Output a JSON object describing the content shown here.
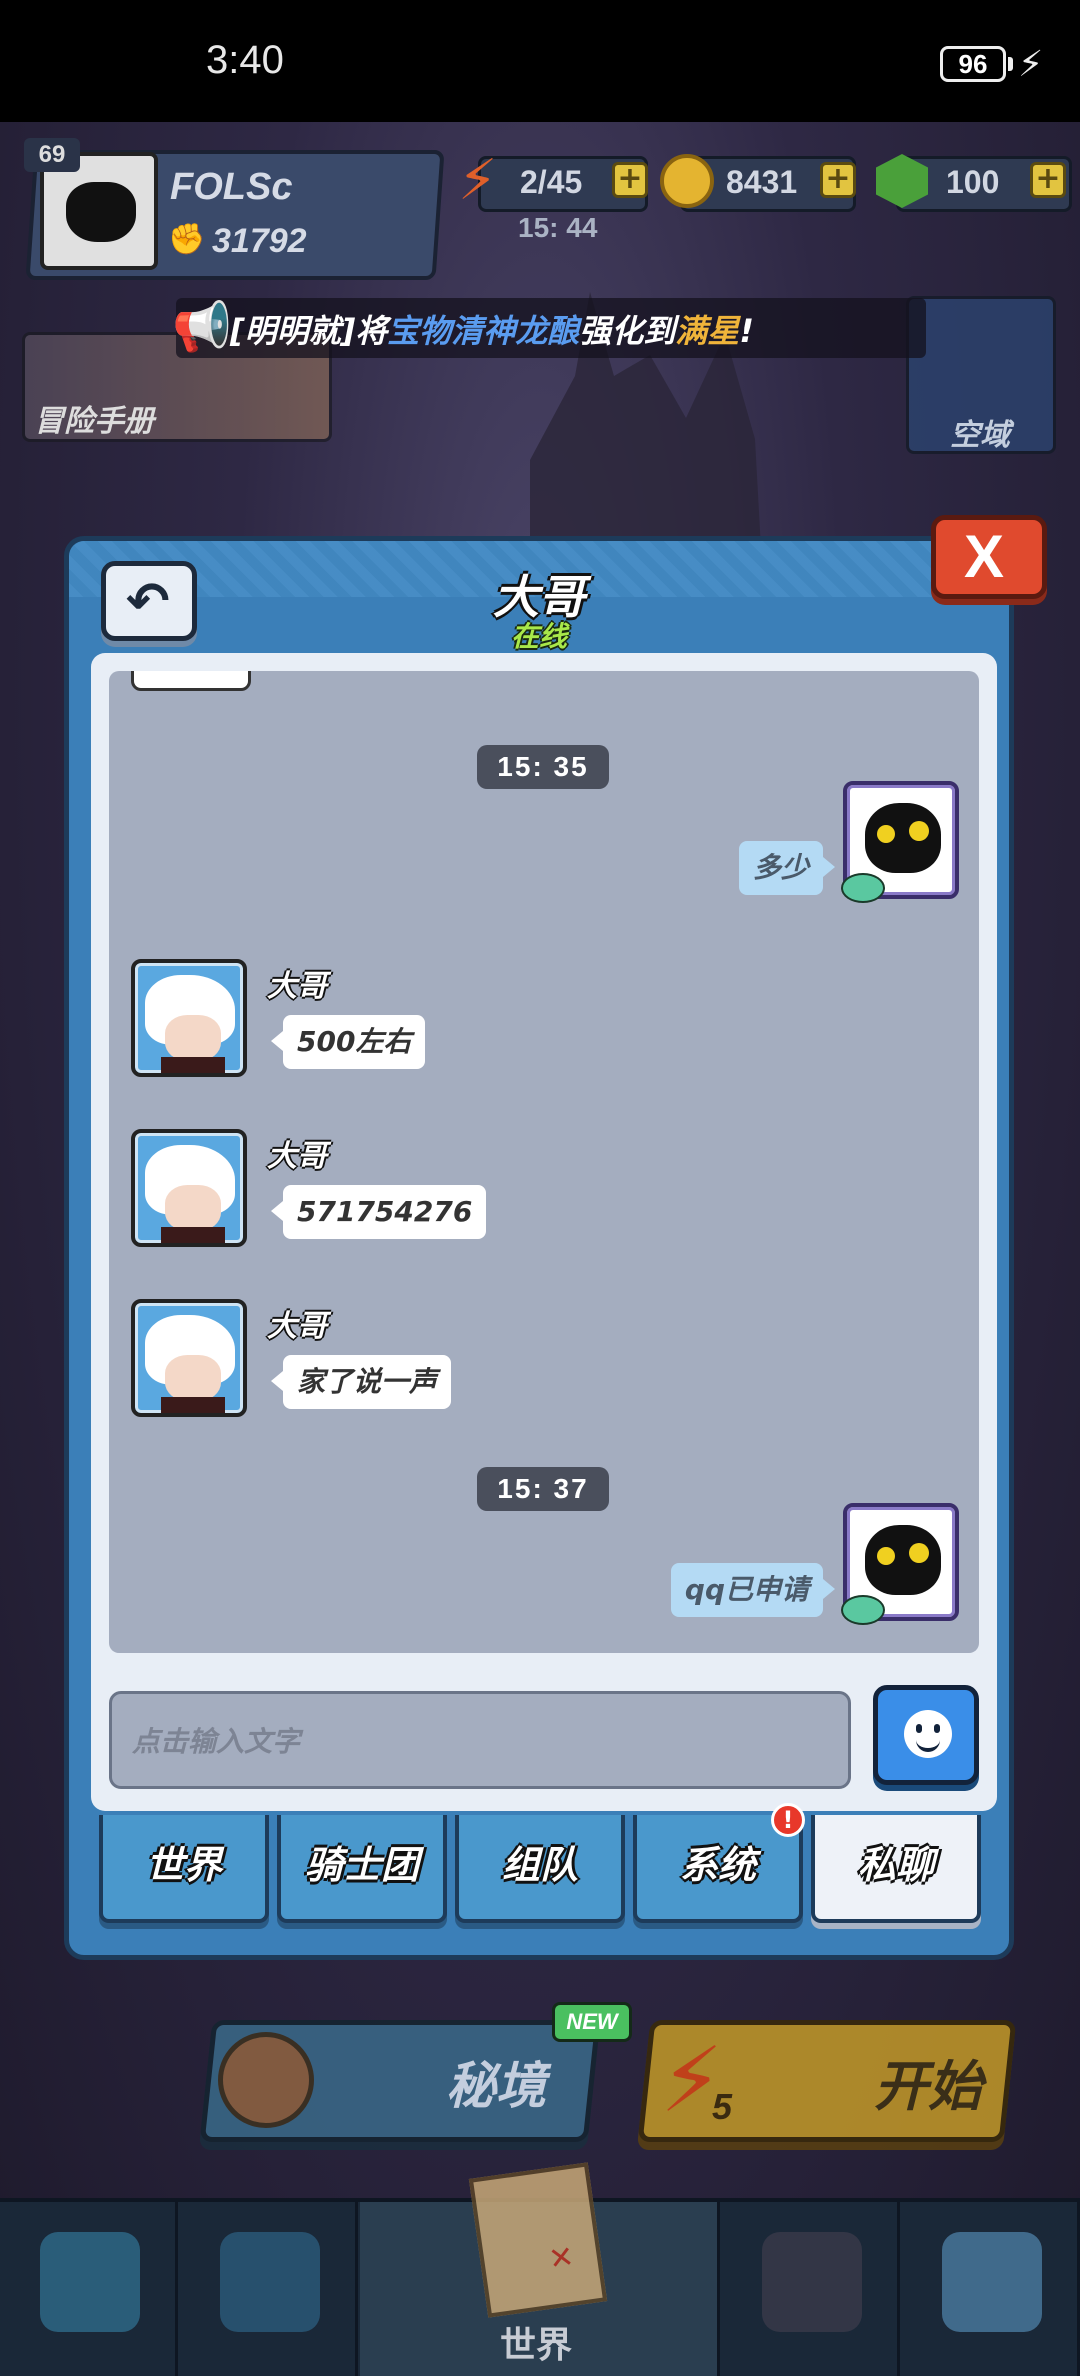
{
  "status_bar": {
    "time": "3:40",
    "battery": "96"
  },
  "player": {
    "level": "69",
    "name": "FOLSc",
    "power": "31792"
  },
  "resources": {
    "energy": "2/45",
    "energy_timer": "15: 44",
    "coins": "8431",
    "gems": "100",
    "plus": "+"
  },
  "announcement": {
    "part1": "[明明就]将",
    "part2": "宝物清神龙酿",
    "part3": "强化到",
    "part4": "满星",
    "part5": "!"
  },
  "side_cards": {
    "adventure": "冒险手册",
    "skyzone": "空域"
  },
  "chat": {
    "title": "大哥",
    "status": "在线",
    "close": "X",
    "messages": [
      {
        "type": "time",
        "text": "15: 35"
      },
      {
        "type": "out",
        "text": "多少"
      },
      {
        "type": "in",
        "sender": "大哥",
        "text": "500左右"
      },
      {
        "type": "in",
        "sender": "大哥",
        "text": "571754276"
      },
      {
        "type": "in",
        "sender": "大哥",
        "text": "家了说一声"
      },
      {
        "type": "time",
        "text": "15: 37"
      },
      {
        "type": "out",
        "text": "qq已申请"
      }
    ],
    "input_placeholder": "点击输入文字",
    "tabs": [
      {
        "label": "世界",
        "active": false
      },
      {
        "label": "骑士团",
        "active": false
      },
      {
        "label": "组队",
        "active": false
      },
      {
        "label": "系统",
        "active": false,
        "badge": "!"
      },
      {
        "label": "私聊",
        "active": true
      }
    ]
  },
  "bottom": {
    "secret": "秘境",
    "new_badge": "NEW",
    "start": "开始",
    "start_cost": "5",
    "nav_world": "世界"
  },
  "colors": {
    "modal_blue": "#3b7fb8",
    "message_bg": "#a4adbf",
    "online_green": "#a8e84a",
    "close_red": "#e04a2e",
    "outgoing_bubble": "#b4daf4",
    "announce_blue": "#5a9cf0",
    "announce_gold": "#f0b43a"
  },
  "icons": [
    "bolt-icon",
    "megaphone-icon",
    "back-arrow-icon",
    "close-icon",
    "smiley-icon",
    "energy-icon",
    "coin-icon",
    "gem-icon",
    "target-icon",
    "map-icon"
  ]
}
